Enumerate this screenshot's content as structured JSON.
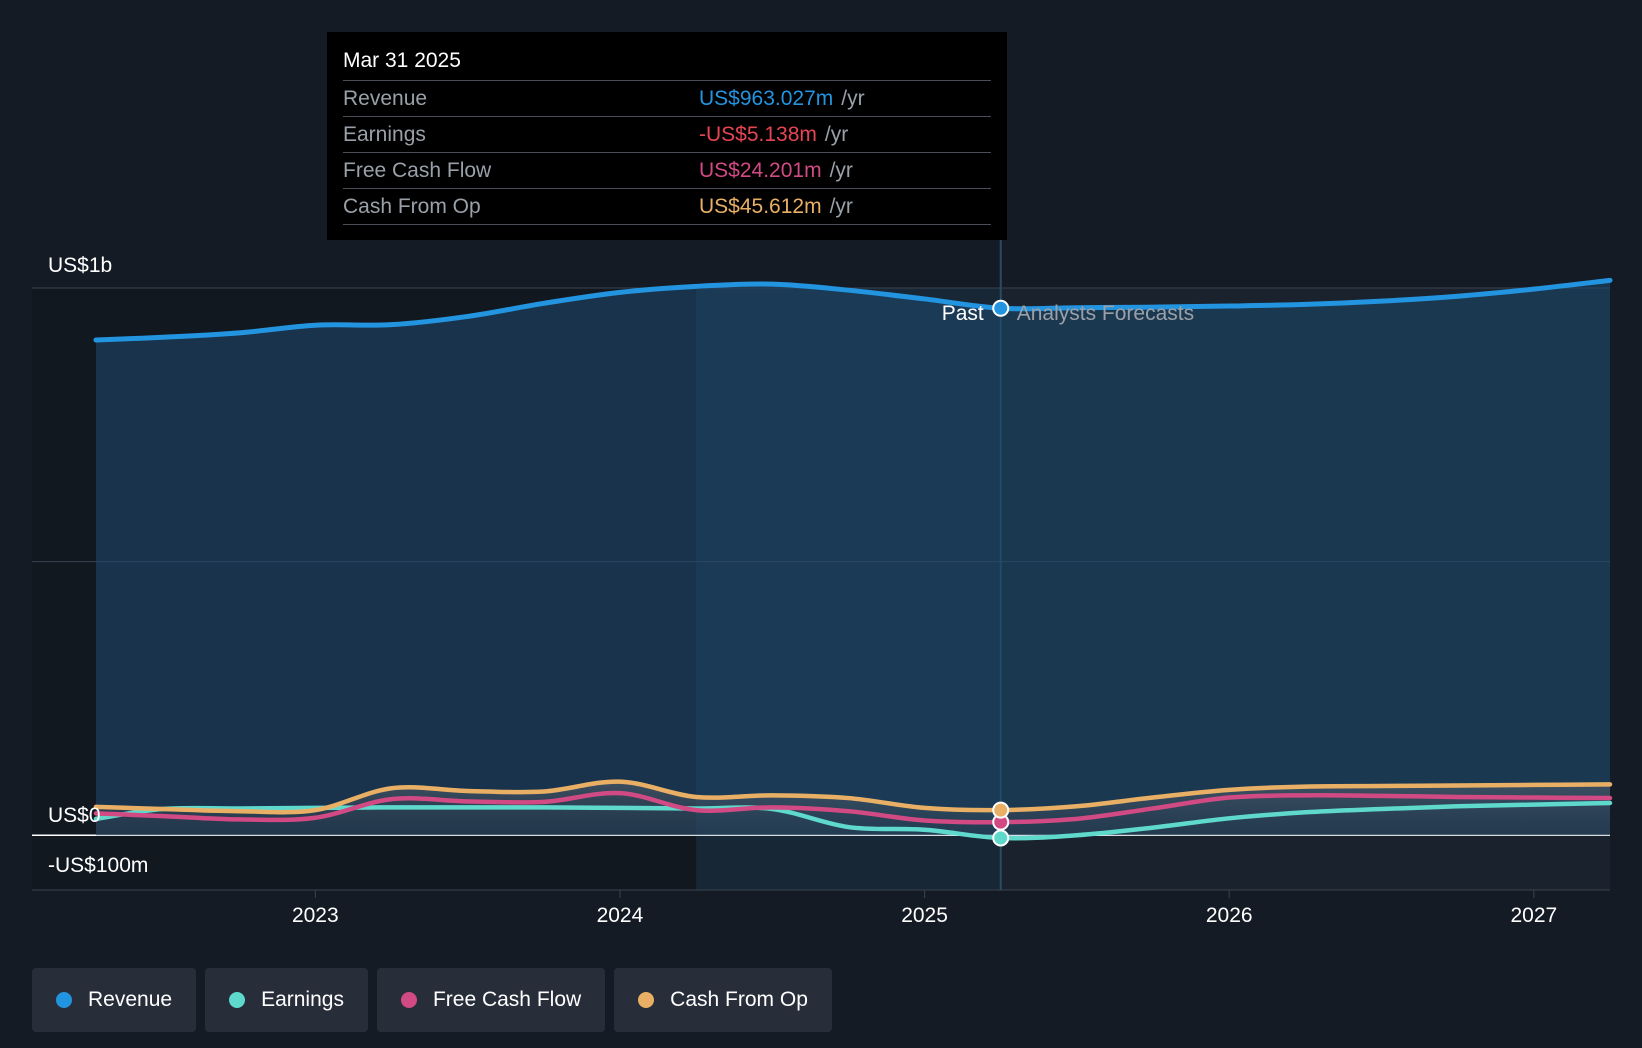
{
  "tooltip": {
    "date": "Mar 31 2025",
    "rows": [
      {
        "label": "Revenue",
        "value": "US$963.027m",
        "unit": "/yr",
        "color": "#2394df"
      },
      {
        "label": "Earnings",
        "value": "-US$5.138m",
        "unit": "/yr",
        "color": "#e64553"
      },
      {
        "label": "Free Cash Flow",
        "value": "US$24.201m",
        "unit": "/yr",
        "color": "#d14a83"
      },
      {
        "label": "Cash From Op",
        "value": "US$45.612m",
        "unit": "/yr",
        "color": "#e9b065"
      }
    ]
  },
  "legend": [
    {
      "label": "Revenue",
      "color": "#2394df"
    },
    {
      "label": "Earnings",
      "color": "#5fd9cc"
    },
    {
      "label": "Free Cash Flow",
      "color": "#d14a83"
    },
    {
      "label": "Cash From Op",
      "color": "#e9b065"
    }
  ],
  "chart_data": {
    "type": "line",
    "y_tick_labels": [
      "US$1b",
      "US$0",
      "-US$100m"
    ],
    "y_ticks": [
      1000,
      0,
      -100
    ],
    "ylim": [
      -100,
      1000
    ],
    "x_tick_labels": [
      "2023",
      "2024",
      "2025",
      "2026",
      "2027"
    ],
    "x_ticks": [
      2023,
      2024,
      2025,
      2026,
      2027
    ],
    "xlim": [
      2022.07,
      2027.25
    ],
    "past_label": "Past",
    "forecast_label": "Analysts Forecasts",
    "highlight_start": 2024.25,
    "divider": 2025.25,
    "series": [
      {
        "name": "Revenue",
        "color": "#2394df",
        "x": [
          2022.28,
          2022.5,
          2022.75,
          2023.0,
          2023.25,
          2023.5,
          2023.75,
          2024.0,
          2024.25,
          2024.5,
          2024.75,
          2025.0,
          2025.25,
          2025.5,
          2025.75,
          2026.0,
          2026.25,
          2026.5,
          2026.75,
          2027.0,
          2027.25
        ],
        "values": [
          905,
          910,
          918,
          932,
          933,
          948,
          972,
          992,
          1003,
          1007,
          996,
          980,
          963,
          964,
          965,
          967,
          970,
          976,
          985,
          998,
          1014
        ]
      },
      {
        "name": "Earnings",
        "color": "#5fd9cc",
        "x": [
          2022.28,
          2022.5,
          2022.75,
          2023.0,
          2023.25,
          2023.5,
          2023.75,
          2024.0,
          2024.25,
          2024.5,
          2024.75,
          2025.0,
          2025.25,
          2025.5,
          2025.75,
          2026.0,
          2026.25,
          2026.5,
          2026.75,
          2027.0,
          2027.25
        ],
        "values": [
          30,
          48,
          49,
          50,
          51,
          51,
          51,
          50,
          49,
          48,
          15,
          10,
          -5,
          0,
          14,
          31,
          42,
          48,
          53,
          56,
          59
        ]
      },
      {
        "name": "Free Cash Flow",
        "color": "#d14a83",
        "x": [
          2022.28,
          2022.5,
          2022.75,
          2023.0,
          2023.25,
          2023.5,
          2023.75,
          2024.0,
          2024.25,
          2024.5,
          2024.75,
          2025.0,
          2025.25,
          2025.5,
          2025.75,
          2026.0,
          2026.25,
          2026.5,
          2026.75,
          2027.0,
          2027.25
        ],
        "values": [
          40,
          35,
          29,
          32,
          66,
          62,
          61,
          77,
          46,
          51,
          44,
          27,
          24,
          30,
          49,
          69,
          73,
          72,
          70,
          69,
          68
        ]
      },
      {
        "name": "Cash From Op",
        "color": "#e9b065",
        "x": [
          2022.28,
          2022.5,
          2022.75,
          2023.0,
          2023.25,
          2023.5,
          2023.75,
          2024.0,
          2024.25,
          2024.5,
          2024.75,
          2025.0,
          2025.25,
          2025.5,
          2025.75,
          2026.0,
          2026.25,
          2026.5,
          2026.75,
          2027.0,
          2027.25
        ],
        "values": [
          52,
          48,
          44,
          46,
          86,
          81,
          80,
          98,
          70,
          73,
          68,
          50,
          46,
          53,
          69,
          83,
          89,
          90,
          91,
          92,
          93
        ]
      }
    ]
  }
}
